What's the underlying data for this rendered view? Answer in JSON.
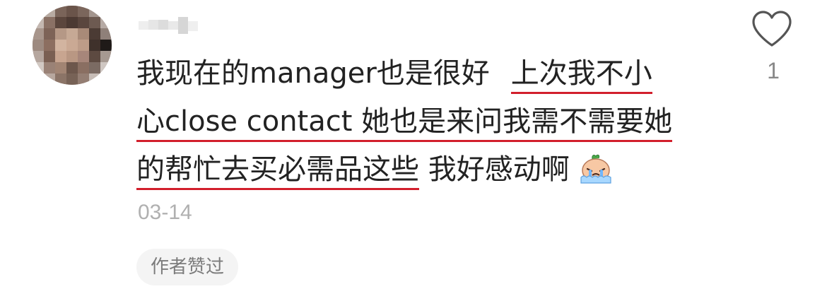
{
  "comment": {
    "username": "",
    "line1_plain": "我现在的manager也是很好",
    "line1_underlined": "上次我不小",
    "line2_underlined": "心close contact 她也是来问我需不需要她",
    "line3_underlined": "的帮忙去买必需品这些",
    "line3_plain": "我好感动啊",
    "emoji": "crying-face-emoji",
    "date": "03-14",
    "author_badge": "作者赞过",
    "like_icon": "heart-outline-icon",
    "like_count": "1"
  },
  "colors": {
    "underline": "#d21f2c",
    "text": "#222222",
    "meta": "#b0b0b0",
    "badge_bg": "#f4f4f4"
  }
}
